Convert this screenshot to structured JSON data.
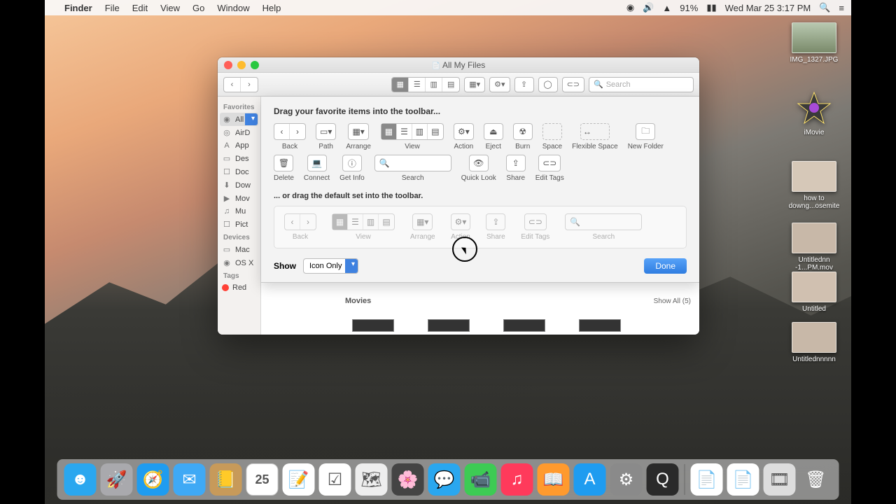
{
  "menubar": {
    "app": "Finder",
    "items": [
      "File",
      "Edit",
      "View",
      "Go",
      "Window",
      "Help"
    ],
    "battery": "91%",
    "datetime": "Wed Mar 25  3:17 PM"
  },
  "desktop_icons": [
    {
      "label": "IMG_1327.JPG",
      "kind": "img"
    },
    {
      "label": "iMovie",
      "kind": "star"
    },
    {
      "label": "how to downg...osemite",
      "kind": "img"
    },
    {
      "label": "Untitlednn -1...PM.mov",
      "kind": "img"
    },
    {
      "label": "Untitled",
      "kind": "img"
    },
    {
      "label": "Untitlednnnnn",
      "kind": "img"
    }
  ],
  "window": {
    "title": "All My Files",
    "search_placeholder": "Search",
    "sidebar": {
      "favorites_hdr": "Favorites",
      "favorites": [
        "All M",
        "AirD",
        "App",
        "Des",
        "Doc",
        "Dow",
        "Mov",
        "Mu",
        "Pict"
      ],
      "devices_hdr": "Devices",
      "devices": [
        "Mac",
        "OS X"
      ],
      "tags_hdr": "Tags",
      "tags": [
        "Red"
      ]
    },
    "panel": {
      "title": "Drag your favorite items into the toolbar...",
      "row1": [
        {
          "id": "back",
          "label": "Back"
        },
        {
          "id": "path",
          "label": "Path"
        },
        {
          "id": "arrange",
          "label": "Arrange"
        },
        {
          "id": "view",
          "label": "View"
        },
        {
          "id": "action",
          "label": "Action"
        },
        {
          "id": "eject",
          "label": "Eject"
        },
        {
          "id": "burn",
          "label": "Burn"
        },
        {
          "id": "space",
          "label": "Space"
        },
        {
          "id": "flex",
          "label": "Flexible Space"
        }
      ],
      "row2": [
        {
          "id": "newfolder",
          "label": "New Folder"
        },
        {
          "id": "delete",
          "label": "Delete"
        },
        {
          "id": "connect",
          "label": "Connect"
        },
        {
          "id": "getinfo",
          "label": "Get Info"
        },
        {
          "id": "search",
          "label": "Search"
        },
        {
          "id": "quicklook",
          "label": "Quick Look"
        },
        {
          "id": "share",
          "label": "Share"
        },
        {
          "id": "edittags",
          "label": "Edit Tags"
        }
      ],
      "subtitle": "... or drag the default set into the toolbar.",
      "defaultset": [
        "Back",
        "View",
        "Arrange",
        "Action",
        "Share",
        "Edit Tags",
        "Search"
      ],
      "show_label": "Show",
      "show_value": "Icon Only",
      "done": "Done"
    },
    "movies_hdr": "Movies",
    "show_all": "Show All (5)"
  },
  "dock": [
    {
      "name": "finder",
      "bg": "#2aa7ef",
      "glyph": "☻"
    },
    {
      "name": "launchpad",
      "bg": "#a9a9ad",
      "glyph": "🚀"
    },
    {
      "name": "safari",
      "bg": "#1f9cf0",
      "glyph": "🧭"
    },
    {
      "name": "mail",
      "bg": "#3fa9f5",
      "glyph": "✉"
    },
    {
      "name": "contacts",
      "bg": "#c79a5a",
      "glyph": "📒"
    },
    {
      "name": "calendar",
      "bg": "#fff",
      "glyph": "25"
    },
    {
      "name": "notes",
      "bg": "#fff",
      "glyph": "📝"
    },
    {
      "name": "reminders",
      "bg": "#fff",
      "glyph": "☑"
    },
    {
      "name": "maps",
      "bg": "#eee",
      "glyph": "🗺"
    },
    {
      "name": "photos",
      "bg": "#444",
      "glyph": "🌸"
    },
    {
      "name": "messages",
      "bg": "#2aa7ef",
      "glyph": "💬"
    },
    {
      "name": "facetime",
      "bg": "#3dcb54",
      "glyph": "📹"
    },
    {
      "name": "itunes",
      "bg": "#ff3a5b",
      "glyph": "♫"
    },
    {
      "name": "ibooks",
      "bg": "#ff9a2e",
      "glyph": "📖"
    },
    {
      "name": "appstore",
      "bg": "#1f9cf0",
      "glyph": "A"
    },
    {
      "name": "sysprefs",
      "bg": "#8a8a8a",
      "glyph": "⚙"
    },
    {
      "name": "quicktime",
      "bg": "#2a2a2a",
      "glyph": "Q"
    },
    {
      "name": "doc",
      "bg": "#fff",
      "glyph": "📄"
    },
    {
      "name": "page",
      "bg": "#fff",
      "glyph": "📄"
    },
    {
      "name": "video",
      "bg": "#ddd",
      "glyph": "🎞"
    },
    {
      "name": "trash",
      "bg": "transparent",
      "glyph": "🗑"
    }
  ]
}
